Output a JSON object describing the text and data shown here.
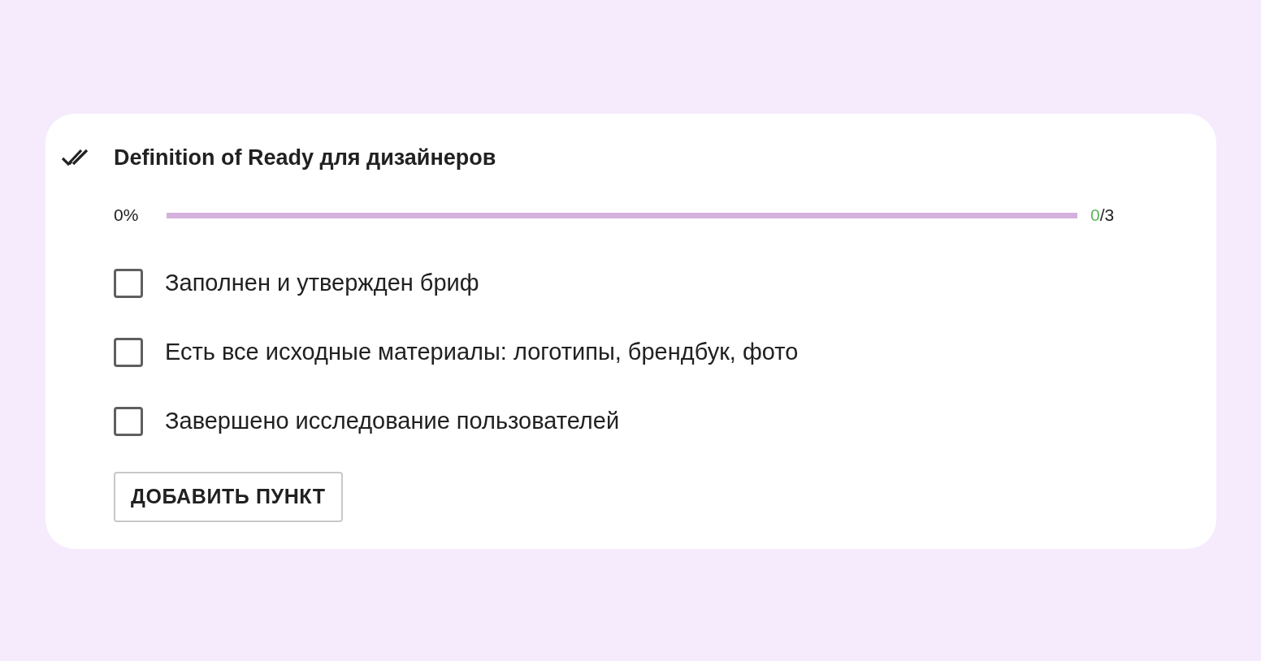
{
  "checklist": {
    "title": "Definition of Ready для дизайнеров",
    "progress": {
      "percent": "0%",
      "level": 0,
      "done": "0",
      "total": "/3"
    },
    "items": [
      {
        "label": "Заполнен и утвержден бриф",
        "checked": false
      },
      {
        "label": "Есть все исходные материалы: логотипы, брендбук, фото",
        "checked": false
      },
      {
        "label": "Завершено исследование пользователей",
        "checked": false
      }
    ],
    "add_button": "ДОБАВИТЬ ПУНКТ"
  }
}
